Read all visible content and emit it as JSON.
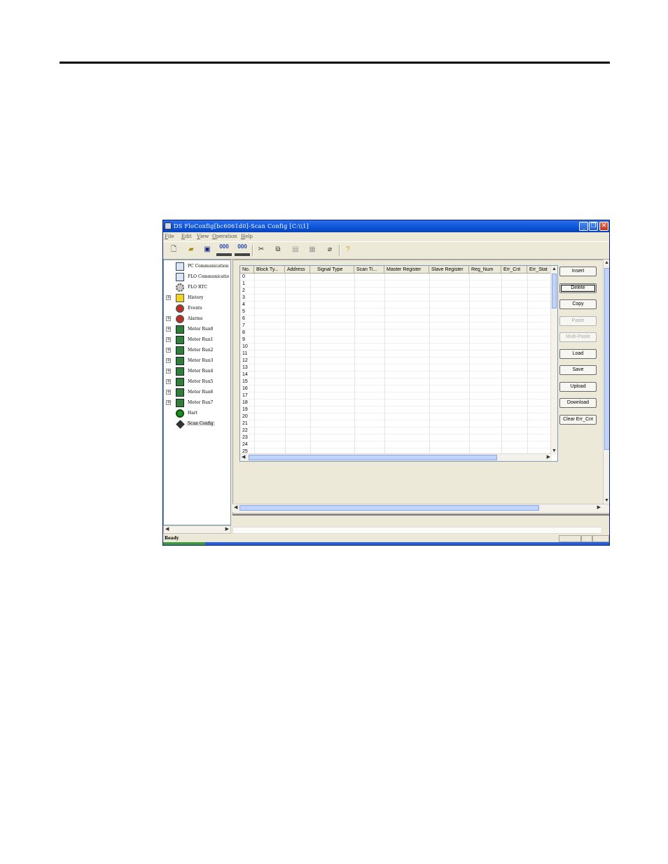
{
  "window": {
    "title": "DS FloConfig[bc6061d0]-Scan Config [C:\\\\1]",
    "minimize_glyph": "_",
    "maximize_glyph": "❐",
    "close_glyph": "✕"
  },
  "menu": [
    "File",
    "Edit",
    "View",
    "Operation",
    "Help"
  ],
  "toolbar": {
    "icons": [
      "new-file-icon",
      "open-folder-icon",
      "save-disk-icon",
      "connect-icon",
      "disconnect-icon",
      "cut-icon",
      "copy-icon",
      "paste-icon",
      "multi-paste-icon",
      "erase-icon",
      "help-icon"
    ],
    "connect_glyph": "000",
    "disconnect_glyph": "000"
  },
  "tree": {
    "items": [
      {
        "label": "PC Communication",
        "expandable": false
      },
      {
        "label": "FLO Communicatio",
        "expandable": false
      },
      {
        "label": "FLO RTC",
        "expandable": false
      },
      {
        "label": "History",
        "expandable": true
      },
      {
        "label": "Events",
        "expandable": false
      },
      {
        "label": "Alarms",
        "expandable": true
      },
      {
        "label": "Meter Run0",
        "expandable": true
      },
      {
        "label": "Meter Run1",
        "expandable": true
      },
      {
        "label": "Meter Run2",
        "expandable": true
      },
      {
        "label": "Meter Run3",
        "expandable": true
      },
      {
        "label": "Meter Run4",
        "expandable": true
      },
      {
        "label": "Meter Run5",
        "expandable": true
      },
      {
        "label": "Meter Run6",
        "expandable": true
      },
      {
        "label": "Meter Run7",
        "expandable": true
      },
      {
        "label": "Hart",
        "expandable": false
      },
      {
        "label": "Scan Config",
        "expandable": false,
        "selected": true
      }
    ],
    "expand_glyph": "+"
  },
  "grid": {
    "columns": [
      "No.",
      "Block Ty...",
      "Address",
      "Signal Type",
      "Scan Ti...",
      "Master Register",
      "Slave Register",
      "Reg_Num",
      "Err_Cnt",
      "Err_Stat"
    ],
    "rows": [
      "0",
      "1",
      "2",
      "3",
      "4",
      "5",
      "6",
      "7",
      "8",
      "9",
      "10",
      "11",
      "12",
      "13",
      "14",
      "15",
      "16",
      "17",
      "18",
      "19",
      "20",
      "21",
      "22",
      "23",
      "24",
      "25"
    ]
  },
  "actions": {
    "insert": "Insert",
    "delete": "Delete",
    "copy": "Copy",
    "paste": "Paste",
    "multi_paste": "Multi-Paste",
    "load": "Load",
    "save": "Save",
    "upload": "Upload",
    "download": "Download",
    "clear_err_cnt": "Clear Err_Cnt"
  },
  "status": {
    "text": "Ready"
  },
  "colors": {
    "titlebar": "#0a53d6",
    "window_bg": "#ece9d8",
    "scroll_thumb": "#c1d3fb",
    "close_button": "#c23a1c"
  }
}
